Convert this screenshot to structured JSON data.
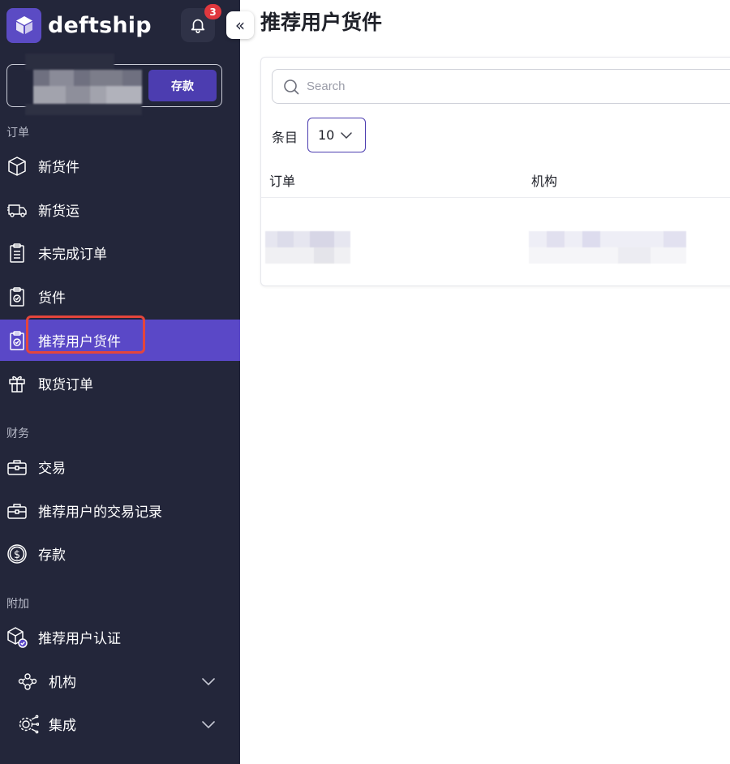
{
  "brand": {
    "name": "deftship",
    "accent": "#5a48c7",
    "sidebar_bg": "#23263a"
  },
  "notifications": {
    "icon": "bell-icon",
    "count": "3"
  },
  "balance": {
    "deposit_label": "存款"
  },
  "collapse": {
    "label": "«"
  },
  "sidebar": {
    "sections": [
      {
        "label": "订单"
      },
      {
        "label": "财务"
      },
      {
        "label": "附加"
      }
    ],
    "items": [
      {
        "label": "新货件",
        "icon": "box-icon"
      },
      {
        "label": "新货运",
        "icon": "truck-icon"
      },
      {
        "label": "未完成订单",
        "icon": "clipboard-list-icon"
      },
      {
        "label": "货件",
        "icon": "clipboard-check-icon"
      },
      {
        "label": "推荐用户货件",
        "icon": "clipboard-check-icon",
        "active": true
      },
      {
        "label": "取货订单",
        "icon": "pickup-icon"
      },
      {
        "label": "交易",
        "icon": "briefcase-icon"
      },
      {
        "label": "推荐用户的交易记录",
        "icon": "briefcase-icon"
      },
      {
        "label": "存款",
        "icon": "dollar-circle-icon"
      },
      {
        "label": "推荐用户认证",
        "icon": "verified-box-icon"
      },
      {
        "label": "机构",
        "icon": "users-network-icon",
        "expandable": true
      },
      {
        "label": "集成",
        "icon": "integration-gear-icon",
        "expandable": true
      }
    ]
  },
  "main": {
    "title": "推荐用户货件",
    "search": {
      "placeholder": "Search"
    },
    "entries": {
      "label": "条目",
      "value": "10"
    },
    "table": {
      "columns": [
        "订单",
        "机构"
      ]
    }
  }
}
